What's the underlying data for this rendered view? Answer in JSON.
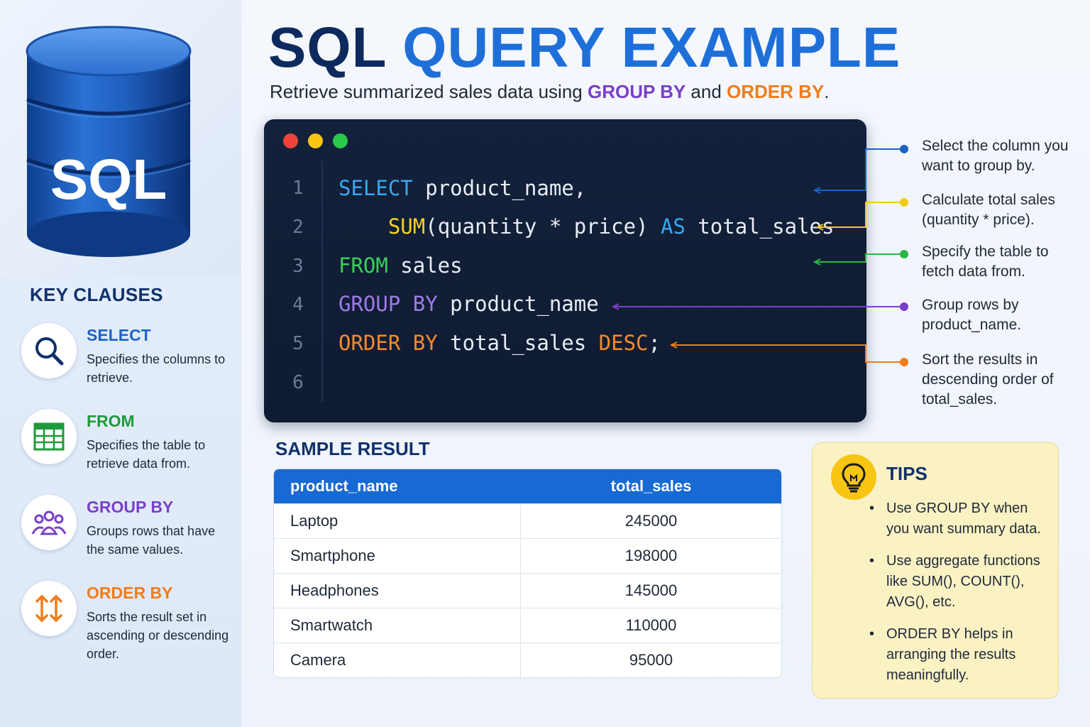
{
  "header": {
    "title_part1": "SQL",
    "title_part2": "QUERY EXAMPLE",
    "subtitle_pre": "Retrieve summarized sales data using ",
    "subtitle_kw1": "GROUP BY",
    "subtitle_mid": " and ",
    "subtitle_kw2": "ORDER BY",
    "subtitle_post": "."
  },
  "logo": {
    "label": "SQL",
    "icon": "database-icon"
  },
  "key_clauses": {
    "title": "KEY CLAUSES",
    "items": [
      {
        "name": "SELECT",
        "desc": "Specifies the columns to retrieve.",
        "icon": "magnifier-icon",
        "color": "#1a64c8"
      },
      {
        "name": "FROM",
        "desc": "Specifies the table to retrieve data from.",
        "icon": "table-icon",
        "color": "#1e9a3a"
      },
      {
        "name": "GROUP BY",
        "desc": "Groups rows that have the same values.",
        "icon": "users-group-icon",
        "color": "#7a3fc9"
      },
      {
        "name": "ORDER BY",
        "desc": "Sorts the result set in ascending or descending order.",
        "icon": "sort-arrows-icon",
        "color": "#f07c1a"
      }
    ]
  },
  "code": {
    "line_numbers": [
      "1",
      "2",
      "3",
      "4",
      "5",
      "6"
    ],
    "l1_kw": "SELECT",
    "l1_rest": " product_name,",
    "l2_indent": "    ",
    "l2_fn": "SUM",
    "l2_mid": "(quantity * price) ",
    "l2_kw": "AS",
    "l2_rest": " total_sales",
    "l3_kw": "FROM",
    "l3_rest": " sales",
    "l4_kw": "GROUP BY",
    "l4_rest": " product_name",
    "l5_kw": "ORDER BY",
    "l5_mid": " total_sales ",
    "l5_kw2": "DESC",
    "l5_rest": ";"
  },
  "annotations": [
    {
      "text": "Select the column you want to group by.",
      "color": "#1a64c8"
    },
    {
      "text": "Calculate total sales (quantity * price).",
      "color": "#f2cc12"
    },
    {
      "text": "Specify the table to fetch data from.",
      "color": "#27b944"
    },
    {
      "text": "Group rows by product_name.",
      "color": "#7a3fc9"
    },
    {
      "text": "Sort the results in descending order of total_sales.",
      "color": "#f07c1a"
    }
  ],
  "sample_result": {
    "title": "SAMPLE RESULT",
    "columns": [
      "product_name",
      "total_sales"
    ],
    "rows": [
      [
        "Laptop",
        "245000"
      ],
      [
        "Smartphone",
        "198000"
      ],
      [
        "Headphones",
        "145000"
      ],
      [
        "Smartwatch",
        "110000"
      ],
      [
        "Camera",
        "95000"
      ]
    ]
  },
  "tips": {
    "title": "TIPS",
    "icon": "lightbulb-icon",
    "items": [
      "Use GROUP BY when you want summary data.",
      "Use aggregate functions like SUM(), COUNT(), AVG(), etc.",
      "ORDER BY helps in arranging the results meaningfully."
    ]
  },
  "window_controls": {
    "close": "#f0443a",
    "minimize": "#f7c512",
    "maximize": "#2ac84a"
  }
}
